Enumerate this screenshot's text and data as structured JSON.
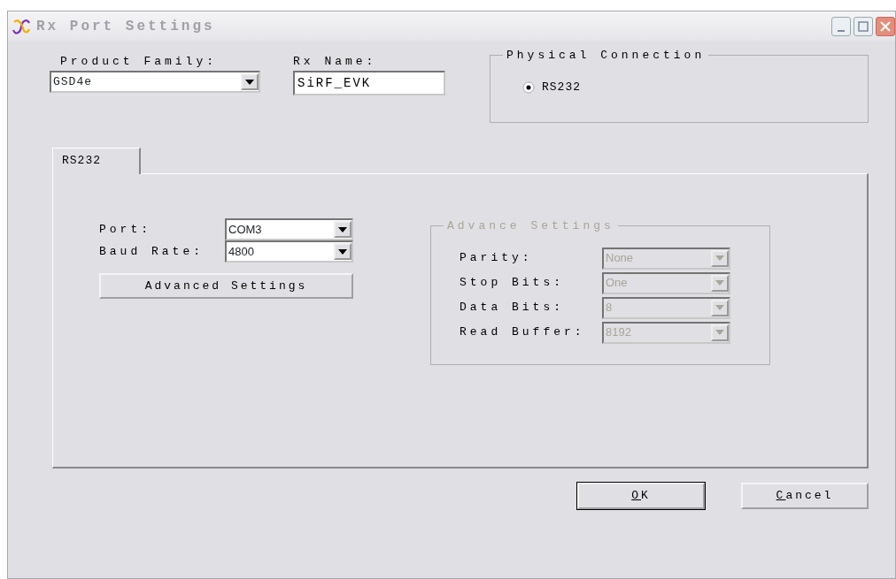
{
  "window": {
    "title": "Rx Port Settings",
    "active": false
  },
  "product_family": {
    "label": "Product Family:",
    "value": "GSD4e"
  },
  "rx_name": {
    "label": "Rx Name:",
    "value": "SiRF_EVK"
  },
  "physical_connection": {
    "title": "Physical Connection",
    "options": [
      {
        "label": "RS232",
        "selected": true
      }
    ]
  },
  "tabs": [
    {
      "label": "RS232",
      "selected": true
    }
  ],
  "port": {
    "label": "Port:",
    "value": "COM3"
  },
  "baud_rate": {
    "label": "Baud Rate:",
    "value": "4800"
  },
  "advanced_button": {
    "label": "Advanced Settings"
  },
  "advance_settings": {
    "title": "Advance Settings",
    "disabled": true,
    "fields": [
      {
        "label": "Parity:",
        "value": "None"
      },
      {
        "label": "Stop Bits:",
        "value": "One"
      },
      {
        "label": "Data Bits:",
        "value": "8"
      },
      {
        "label": "Read Buffer:",
        "value": "8192"
      }
    ]
  },
  "buttons": [
    {
      "label": "OK",
      "default": true,
      "underline_first": true
    },
    {
      "label": "Cancel",
      "default": false,
      "underline_first": true
    }
  ]
}
